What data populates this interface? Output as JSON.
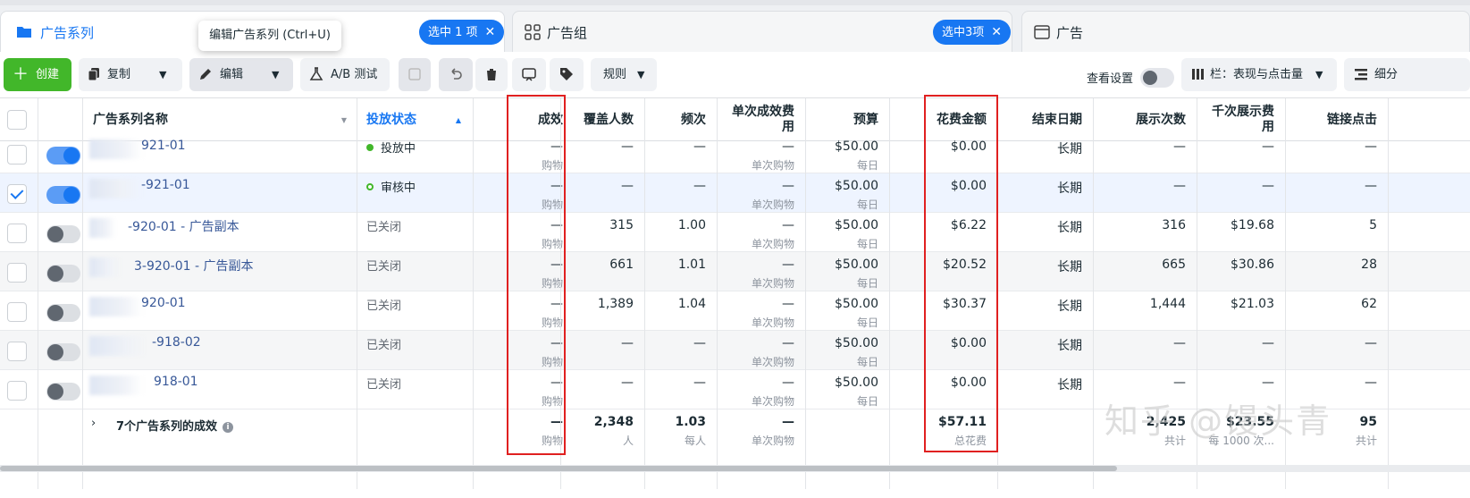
{
  "tabs": [
    {
      "title": "广告系列",
      "selection": "选中 1 项"
    },
    {
      "title": "广告组",
      "selection": "选中3项"
    },
    {
      "title": "广告",
      "selection": ""
    }
  ],
  "tooltip": "编辑广告系列 (Ctrl+U)",
  "toolbar": {
    "create": "创建",
    "duplicate": "复制",
    "edit": "编辑",
    "ab_test": "A/B 测试",
    "rules": "规则",
    "view_settings": "查看设置",
    "columns": "栏：表现与点击量",
    "breakdown": "细分"
  },
  "columns": {
    "name": "广告系列名称",
    "status": "投放状态",
    "results": "成效",
    "reach": "覆盖人数",
    "frequency": "频次",
    "cost_per_result": "单次成效费用",
    "budget": "预算",
    "amount_spent": "花费金额",
    "end_date": "结束日期",
    "impressions": "展示次数",
    "cpm": "千次展示费用",
    "link_clicks": "链接点击"
  },
  "rows": [
    {
      "name": "921-01",
      "status": "投放中",
      "results": "—",
      "results_sub": "购物",
      "reach": "—",
      "frequency": "—",
      "cpr": "—",
      "cpr_sub": "单次购物",
      "budget": "$50.00",
      "budget_sub": "每日",
      "spent": "$0.00",
      "end": "长期",
      "impressions": "—",
      "cpm": "—",
      "clicks": "—"
    },
    {
      "name": "-921-01",
      "status": "审核中",
      "results": "—",
      "results_sub": "购物",
      "reach": "—",
      "frequency": "—",
      "cpr": "—",
      "cpr_sub": "单次购物",
      "budget": "$50.00",
      "budget_sub": "每日",
      "spent": "$0.00",
      "end": "长期",
      "impressions": "—",
      "cpm": "—",
      "clicks": "—"
    },
    {
      "name": "-920-01 - 广告副本",
      "status": "已关闭",
      "results": "—",
      "results_sub": "购物",
      "reach": "315",
      "frequency": "1.00",
      "cpr": "—",
      "cpr_sub": "单次购物",
      "budget": "$50.00",
      "budget_sub": "每日",
      "spent": "$6.22",
      "end": "长期",
      "impressions": "316",
      "cpm": "$19.68",
      "clicks": "5"
    },
    {
      "name": "3-920-01 - 广告副本",
      "status": "已关闭",
      "results": "—",
      "results_sub": "购物",
      "reach": "661",
      "frequency": "1.01",
      "cpr": "—",
      "cpr_sub": "单次购物",
      "budget": "$50.00",
      "budget_sub": "每日",
      "spent": "$20.52",
      "end": "长期",
      "impressions": "665",
      "cpm": "$30.86",
      "clicks": "28"
    },
    {
      "name": "920-01",
      "status": "已关闭",
      "results": "—",
      "results_sub": "购物",
      "reach": "1,389",
      "frequency": "1.04",
      "cpr": "—",
      "cpr_sub": "单次购物",
      "budget": "$50.00",
      "budget_sub": "每日",
      "spent": "$30.37",
      "end": "长期",
      "impressions": "1,444",
      "cpm": "$21.03",
      "clicks": "62"
    },
    {
      "name": "-918-02",
      "status": "已关闭",
      "results": "—",
      "results_sub": "购物",
      "reach": "—",
      "frequency": "—",
      "cpr": "—",
      "cpr_sub": "单次购物",
      "budget": "$50.00",
      "budget_sub": "每日",
      "spent": "$0.00",
      "end": "长期",
      "impressions": "—",
      "cpm": "—",
      "clicks": "—"
    },
    {
      "name": "918-01",
      "status": "已关闭",
      "results": "—",
      "results_sub": "购物",
      "reach": "—",
      "frequency": "—",
      "cpr": "—",
      "cpr_sub": "单次购物",
      "budget": "$50.00",
      "budget_sub": "每日",
      "spent": "$0.00",
      "end": "长期",
      "impressions": "—",
      "cpm": "—",
      "clicks": "—"
    }
  ],
  "summary": {
    "label": "7个广告系列的成效",
    "results": "—",
    "results_sub": "购物",
    "reach": "2,348",
    "reach_sub": "人",
    "frequency": "1.03",
    "frequency_sub": "每人",
    "cpr": "—",
    "cpr_sub": "单次购物",
    "spent": "$57.11",
    "spent_sub": "总花费",
    "impressions": "2,425",
    "impressions_sub": "共计",
    "cpm": "$23.55",
    "cpm_sub": "每 1000 次...",
    "clicks": "95",
    "clicks_sub": "共计"
  },
  "watermark": "知乎 @馒头青",
  "colors": {
    "accent": "#1877f2",
    "create": "#42b72a",
    "highlight": "#e02020"
  }
}
